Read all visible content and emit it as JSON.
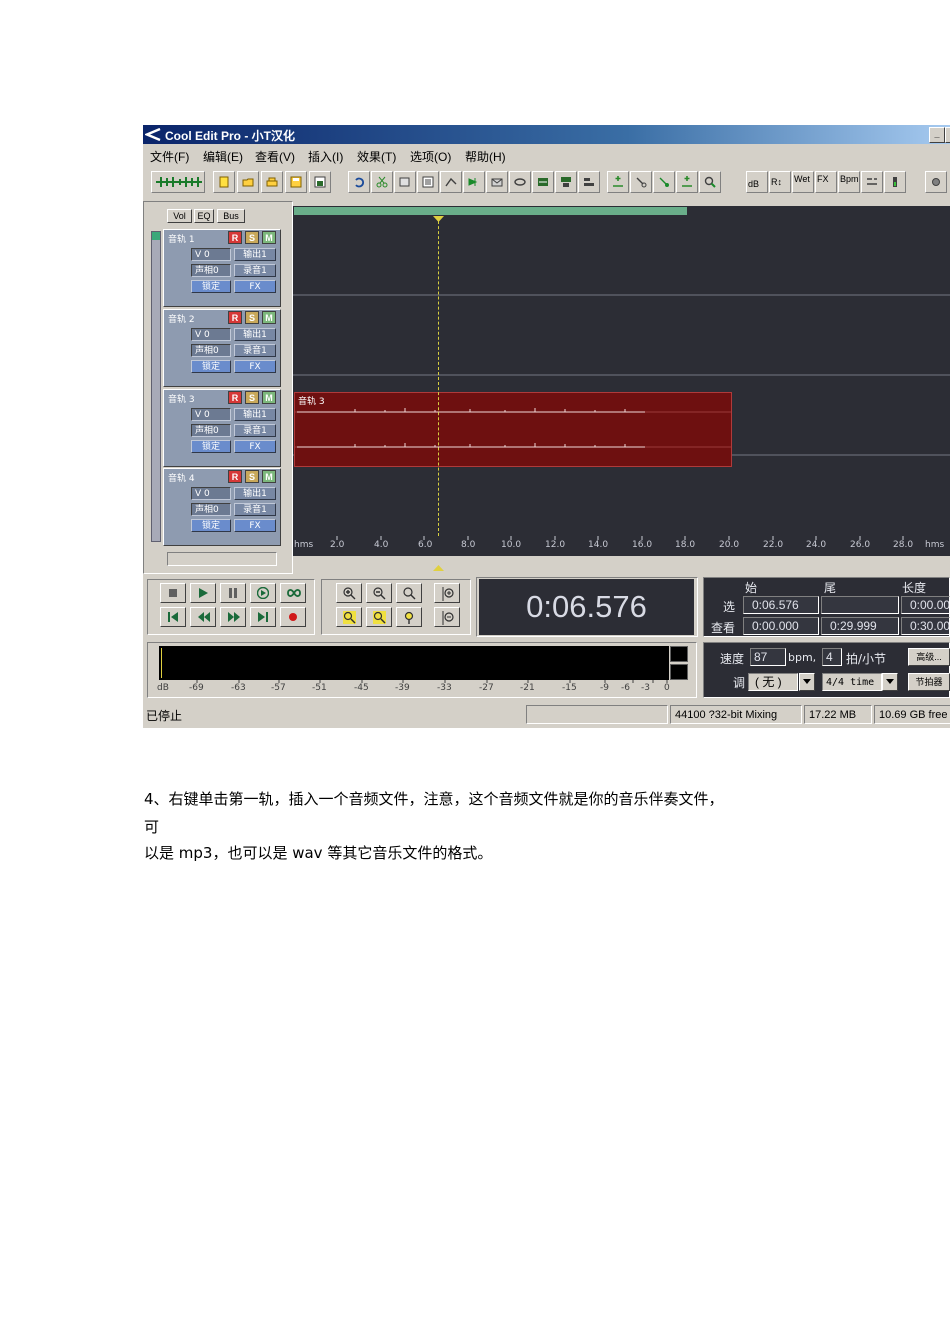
{
  "window": {
    "title": "Cool Edit Pro  - 小T汉化",
    "min_glyph": "_",
    "max_glyph": "□"
  },
  "menu": [
    "文件(F)",
    "编辑(E)",
    "查看(V)",
    "插入(I)",
    "效果(T)",
    "选项(O)",
    "帮助(H)"
  ],
  "toolbar_labels": {
    "db": "dB",
    "rl": "R↕",
    "wet": "Wet",
    "fx": "FX",
    "bpm": "Bpm"
  },
  "panel_tabs": [
    "Vol",
    "EQ",
    "Bus"
  ],
  "tracks": [
    {
      "name": "音轨  1",
      "vol": "V 0",
      "pan": "声相0",
      "out": "输出1",
      "rec": "录音1",
      "lock": "锁定",
      "fx": "FX"
    },
    {
      "name": "音轨  2",
      "vol": "V 0",
      "pan": "声相0",
      "out": "输出1",
      "rec": "录音1",
      "lock": "锁定",
      "fx": "FX"
    },
    {
      "name": "音轨  3",
      "vol": "V 0",
      "pan": "声相0",
      "out": "输出1",
      "rec": "录音1",
      "lock": "锁定",
      "fx": "FX"
    },
    {
      "name": "音轨  4",
      "vol": "V 0",
      "pan": "声相0",
      "out": "输出1",
      "rec": "录音1",
      "lock": "锁定",
      "fx": "FX"
    }
  ],
  "rsm": {
    "r": "R",
    "s": "S",
    "m": "M"
  },
  "clip": {
    "label": "音轨  3"
  },
  "ruler": {
    "unit_left": "hms",
    "unit_right": "hms",
    "ticks": [
      "2.0",
      "4.0",
      "6.0",
      "8.0",
      "10.0",
      "12.0",
      "14.0",
      "16.0",
      "18.0",
      "20.0",
      "22.0",
      "24.0",
      "26.0",
      "28.0"
    ]
  },
  "time_display": "0:06.576",
  "selection": {
    "headers": {
      "begin": "始",
      "end": "尾",
      "length": "长度"
    },
    "sel_label": "选",
    "view_label": "查看",
    "sel_begin": "0:06.576",
    "sel_end": "",
    "sel_length": "0:00.00",
    "view_begin": "0:00.000",
    "view_end": "0:29.999",
    "view_length": "0:30.00"
  },
  "tempo": {
    "speed_label": "速度",
    "bpm_value": "87",
    "bpm_unit": "bpm,",
    "beats_value": "4",
    "beats_label": "拍/小节",
    "key_label": "调",
    "key_value": "( 无 )",
    "time_sig": "4/4 time",
    "advanced_button": "高级...",
    "metronome_button": "节拍器"
  },
  "meter_ticks": [
    "dB",
    "-69",
    "-63",
    "-57",
    "-51",
    "-45",
    "-39",
    "-33",
    "-27",
    "-21",
    "-15",
    "-9",
    "-6",
    "-3",
    "0"
  ],
  "status": {
    "state": "已停止",
    "format": "44100 ?32-bit Mixing",
    "memory": "17.22 MB",
    "disk": "10.69 GB free"
  },
  "caption": {
    "line1": "4、右键单击第一轨，插入一个音频文件，注意，这个音频文件就是你的音乐伴奏文件，",
    "line2": "可",
    "line3": "以是 mp3，也可以是 wav 等其它音乐文件的格式。"
  }
}
